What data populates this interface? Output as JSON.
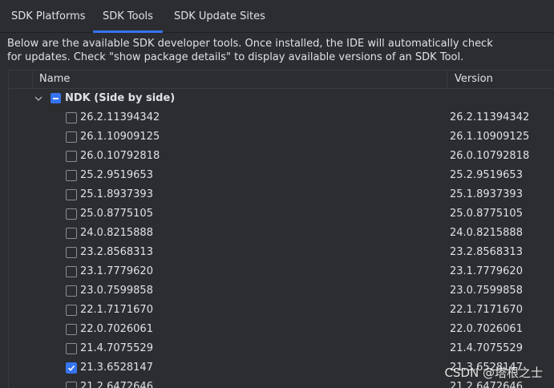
{
  "tabs": [
    {
      "label": "SDK Platforms",
      "active": false
    },
    {
      "label": "SDK Tools",
      "active": true
    },
    {
      "label": "SDK Update Sites",
      "active": false
    }
  ],
  "description": {
    "line1": "Below are the available SDK developer tools. Once installed, the IDE will automatically check",
    "line2": "for updates. Check \"show package details\" to display available versions of an SDK Tool."
  },
  "table": {
    "columns": {
      "name": "Name",
      "version": "Version"
    },
    "parent": {
      "label": "NDK (Side by side)",
      "state": "mixed",
      "expanded": true
    },
    "rows": [
      {
        "name": "26.2.11394342",
        "version": "26.2.11394342",
        "checked": false
      },
      {
        "name": "26.1.10909125",
        "version": "26.1.10909125",
        "checked": false
      },
      {
        "name": "26.0.10792818",
        "version": "26.0.10792818",
        "checked": false
      },
      {
        "name": "25.2.9519653",
        "version": "25.2.9519653",
        "checked": false
      },
      {
        "name": "25.1.8937393",
        "version": "25.1.8937393",
        "checked": false
      },
      {
        "name": "25.0.8775105",
        "version": "25.0.8775105",
        "checked": false
      },
      {
        "name": "24.0.8215888",
        "version": "24.0.8215888",
        "checked": false
      },
      {
        "name": "23.2.8568313",
        "version": "23.2.8568313",
        "checked": false
      },
      {
        "name": "23.1.7779620",
        "version": "23.1.7779620",
        "checked": false
      },
      {
        "name": "23.0.7599858",
        "version": "23.0.7599858",
        "checked": false
      },
      {
        "name": "22.1.7171670",
        "version": "22.1.7171670",
        "checked": false
      },
      {
        "name": "22.0.7026061",
        "version": "22.0.7026061",
        "checked": false
      },
      {
        "name": "21.4.7075529",
        "version": "21.4.7075529",
        "checked": false
      },
      {
        "name": "21.3.6528147",
        "version": "21.3.6528147",
        "checked": true
      },
      {
        "name": "21.2.6472646",
        "version": "21.2.6472646",
        "checked": false
      }
    ]
  },
  "watermark": "CSDN @塔根之士",
  "colors": {
    "background": "#2b2d30",
    "accent": "#3574f0",
    "text": "#dfe1e5",
    "border": "#393b40"
  }
}
